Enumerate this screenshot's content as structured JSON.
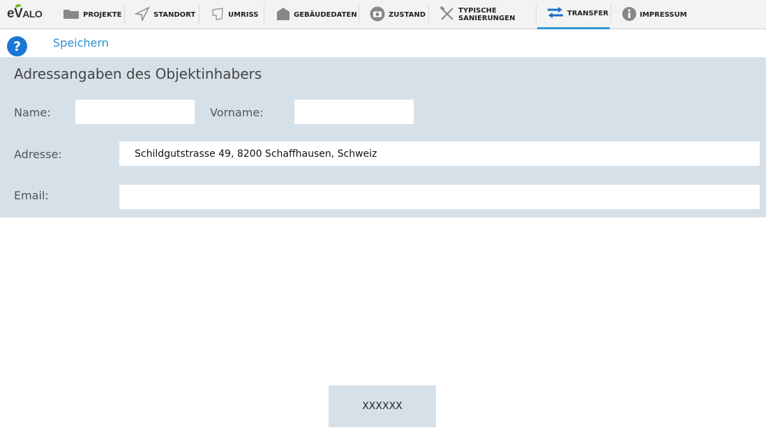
{
  "app": {
    "logo_text": "eVALO"
  },
  "nav": {
    "items": [
      {
        "label": "PROJEKTE",
        "icon": "folder-icon"
      },
      {
        "label": "STANDORT",
        "icon": "location-arrow-icon"
      },
      {
        "label": "UMRISS",
        "icon": "outline-shape-icon"
      },
      {
        "label": "GEBÄUDEDATEN",
        "icon": "house-icon"
      },
      {
        "label": "ZUSTAND",
        "icon": "camera-icon"
      },
      {
        "label_line1": "TYPISCHE",
        "label_line2": "SANIERUNGEN",
        "icon": "tools-icon"
      },
      {
        "label": "TRANSFER",
        "icon": "transfer-arrows-icon",
        "active": true
      },
      {
        "label": "IMPRESSUM",
        "icon": "info-icon"
      }
    ],
    "active_color": "#2a9ad8"
  },
  "toolbar": {
    "help_label": "?",
    "save_label": "Speichern"
  },
  "form": {
    "title": "Adressangaben des Objektinhabers",
    "name_label": "Name:",
    "name_value": "",
    "vorname_label": "Vorname:",
    "vorname_value": "",
    "adresse_label": "Adresse:",
    "adresse_value": "Schildgutstrasse 49, 8200 Schaffhausen, Schweiz",
    "email_label": "Email:",
    "email_value": ""
  },
  "action": {
    "button_label": "XXXXXX"
  },
  "colors": {
    "panel_bg": "#d6e0e8",
    "accent": "#2a8fcf",
    "help_bg": "#1a78d4"
  }
}
